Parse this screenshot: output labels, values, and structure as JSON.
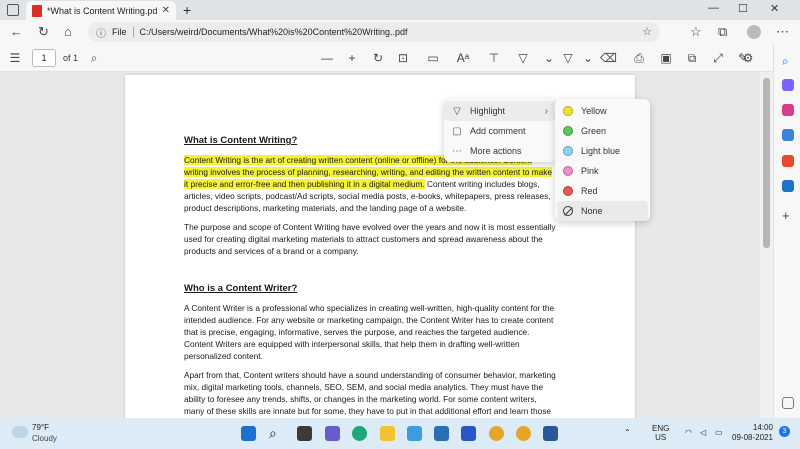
{
  "browser": {
    "tab_title": "*What is Content Writing.pdf",
    "tab_close": "✕",
    "new_tab": "+",
    "window_controls": [
      "—",
      "☐",
      "✕"
    ],
    "address_info": "File",
    "address_url": "C:/Users/weird/Documents/What%20is%20Content%20Writing..pdf"
  },
  "pdf_toolbar": {
    "page_number": "1",
    "page_count_label": "of 1",
    "icons": [
      "contents-icon",
      "search-icon",
      "zoom-out-icon",
      "zoom-in-icon",
      "rotate-icon",
      "fit-page-icon",
      "page-view-icon",
      "read-aloud-icon",
      "add-text-icon",
      "draw-icon",
      "highlight-icon",
      "erase-icon",
      "print-icon",
      "save-icon",
      "save-as-icon",
      "fullscreen-icon",
      "pin-icon",
      "settings-icon"
    ]
  },
  "document": {
    "heading1": "What is Content Writing?",
    "para1_highlighted": " Content Writing is the art of creating written content (online or offline) for the audience. Content writing involves the process of planning, researching, writing, and editing the written content to make it precise and error-free and then publishing it in a digital medium.",
    "para1_rest": " Content writing includes blogs, articles, video scripts, podcast/Ad scripts, social media posts, e-books, whitepapers, press releases, product descriptions, marketing materials, and the landing page of a website.",
    "para2": "The purpose and scope of Content Writing have evolved over the years and now it is most essentially used for creating digital marketing materials to attract customers and spread awareness about the products and services of a brand or a company.",
    "heading2": "Who is a Content Writer?",
    "para3": "A Content Writer is a professional who specializes in creating well-written, high-quality content for the intended audience. For any website or marketing campaign, the Content Writer has to create content that is precise, engaging, informative, serves the purpose, and reaches the targeted audience. Content Writers are equipped with interpersonal skills, that help them in drafting well-written personalized content.",
    "para4": " Apart from that, Content writers should have a sound understanding of consumer behavior, marketing mix, digital marketing tools, channels, SEO, SEM, and social media analytics. They must have the ability to foresee any trends, shifts, or changes in the marketing world. For some content writers, many of these skills are innate but for some, they have to put in that additional effort and learn those skills"
  },
  "context_menu": {
    "items": [
      {
        "label": "Highlight",
        "icon": "highlighter-icon"
      },
      {
        "label": "Add comment",
        "icon": "comment-icon"
      },
      {
        "label": "More actions",
        "icon": "more-icon"
      }
    ],
    "submenu_arrow": "›"
  },
  "highlight_submenu": {
    "items": [
      {
        "label": "Yellow",
        "color": "#f5e12a"
      },
      {
        "label": "Green",
        "color": "#5cc85c"
      },
      {
        "label": "Light blue",
        "color": "#8fd3f4"
      },
      {
        "label": "Pink",
        "color": "#f08fc8"
      },
      {
        "label": "Red",
        "color": "#e85a4f"
      },
      {
        "label": "None",
        "color": ""
      }
    ]
  },
  "taskbar": {
    "temperature": "79°F",
    "condition": "Cloudy",
    "language": "ENG",
    "region": "US",
    "time": "14:00",
    "date": "09-08-2021",
    "notification_count": "3"
  }
}
